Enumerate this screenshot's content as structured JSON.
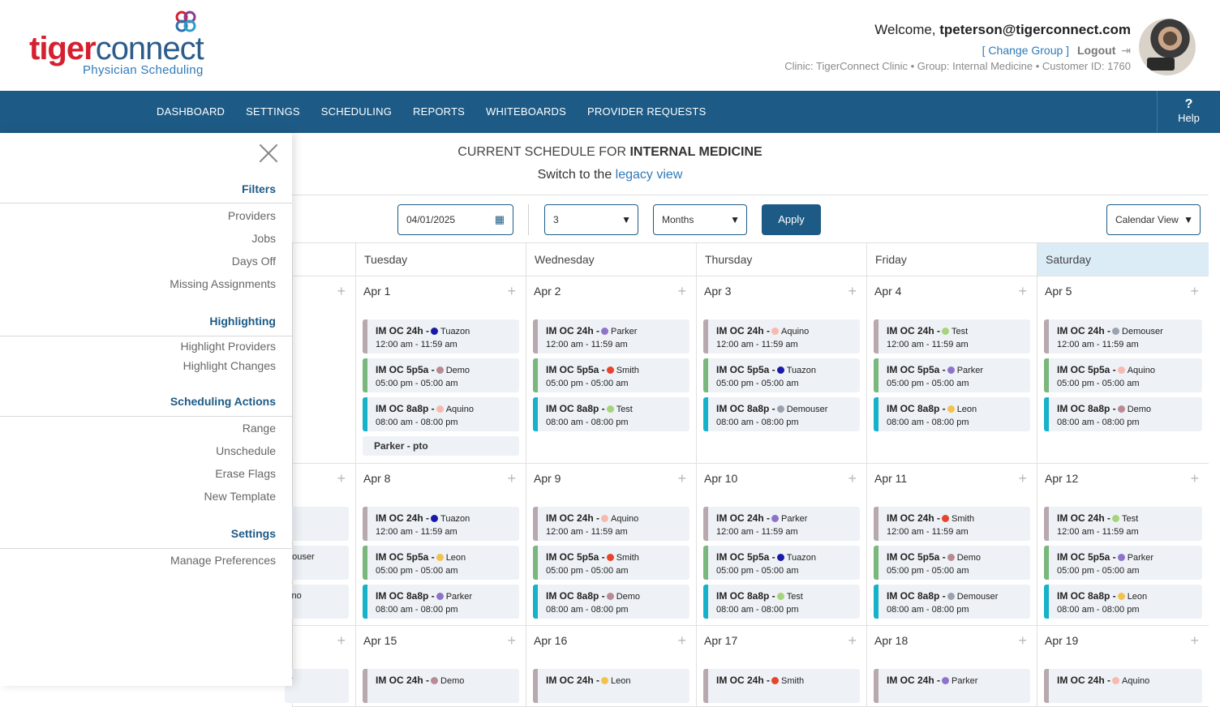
{
  "brand": {
    "word_a": "tiger",
    "word_b": "connect",
    "subtitle": "Physician Scheduling",
    "colors": {
      "red": "#d6202f",
      "blue": "#2c5c8a",
      "nav": "#1d5b86"
    }
  },
  "account": {
    "welcome_prefix": "Welcome,",
    "user": "tpeterson@tigerconnect.com",
    "change_group": "[ Change Group ]",
    "logout": "Logout",
    "clinic_line": "Clinic: TigerConnect Clinic • Group: Internal Medicine • Customer ID: 1760"
  },
  "nav": {
    "items": [
      "DASHBOARD",
      "SETTINGS",
      "SCHEDULING",
      "REPORTS",
      "WHITEBOARDS",
      "PROVIDER REQUESTS"
    ],
    "help_icon": "?",
    "help_label": "Help"
  },
  "page": {
    "title_prefix": "CURRENT SCHEDULE FOR",
    "title_group": "INTERNAL MEDICINE",
    "switch_prefix": "Switch to the",
    "switch_link": "legacy view"
  },
  "toolbar": {
    "date_value": "04/01/2025",
    "count_value": "3",
    "unit_value": "Months",
    "apply_label": "Apply",
    "view_value": "Calendar View"
  },
  "sidebar": {
    "sections": [
      {
        "title": "Filters",
        "items": [
          "Providers",
          "Jobs",
          "Days Off",
          "Missing Assignments"
        ]
      },
      {
        "title": "Highlighting",
        "items": [
          "Highlight Providers",
          "Highlight Changes"
        ]
      },
      {
        "title": "Scheduling Actions",
        "items": [
          "Range",
          "Unschedule",
          "Erase Flags",
          "New Template"
        ]
      },
      {
        "title": "Settings",
        "items": [
          "Manage Preferences"
        ]
      }
    ]
  },
  "calendar": {
    "days": [
      "Tuesday",
      "Wednesday",
      "Thursday",
      "Friday",
      "Saturday"
    ],
    "provider_colors": {
      "Tuazon": "#1a1aa8",
      "Parker": "#8f72cc",
      "Aquino": "#f7b9b0",
      "Test": "#a6d47a",
      "Demouser": "#9aa3ad",
      "Demo": "#b98a94",
      "Smith": "#e8432c",
      "Leon": "#f3c24e"
    },
    "weeks": [
      {
        "days": [
          {
            "label": "Apr 1",
            "shifts": [
              {
                "job": "IM OC 24h -",
                "provider": "Tuazon",
                "time": "12:00 am - 11:59 am",
                "cls": ""
              },
              {
                "job": "IM OC 5p5a -",
                "provider": "Demo",
                "time": "05:00 pm - 05:00 am",
                "cls": "c-green"
              },
              {
                "job": "IM OC 8a8p -",
                "provider": "Aquino",
                "time": "08:00 am - 08:00 pm",
                "cls": "c-cyan"
              }
            ],
            "pto": "Parker - pto"
          },
          {
            "label": "Apr 2",
            "shifts": [
              {
                "job": "IM OC 24h -",
                "provider": "Parker",
                "time": "12:00 am - 11:59 am",
                "cls": ""
              },
              {
                "job": "IM OC 5p5a -",
                "provider": "Smith",
                "time": "05:00 pm - 05:00 am",
                "cls": "c-green"
              },
              {
                "job": "IM OC 8a8p -",
                "provider": "Test",
                "time": "08:00 am - 08:00 pm",
                "cls": "c-cyan"
              }
            ]
          },
          {
            "label": "Apr 3",
            "shifts": [
              {
                "job": "IM OC 24h -",
                "provider": "Aquino",
                "time": "12:00 am - 11:59 am",
                "cls": ""
              },
              {
                "job": "IM OC 5p5a -",
                "provider": "Tuazon",
                "time": "05:00 pm - 05:00 am",
                "cls": "c-green"
              },
              {
                "job": "IM OC 8a8p -",
                "provider": "Demouser",
                "time": "08:00 am - 08:00 pm",
                "cls": "c-cyan"
              }
            ]
          },
          {
            "label": "Apr 4",
            "shifts": [
              {
                "job": "IM OC 24h -",
                "provider": "Test",
                "time": "12:00 am - 11:59 am",
                "cls": ""
              },
              {
                "job": "IM OC 5p5a -",
                "provider": "Parker",
                "time": "05:00 pm - 05:00 am",
                "cls": "c-green"
              },
              {
                "job": "IM OC 8a8p -",
                "provider": "Leon",
                "time": "08:00 am - 08:00 pm",
                "cls": "c-cyan"
              }
            ]
          },
          {
            "label": "Apr 5",
            "shifts": [
              {
                "job": "IM OC 24h -",
                "provider": "Demouser",
                "time": "12:00 am - 11:59 am",
                "cls": ""
              },
              {
                "job": "IM OC 5p5a -",
                "provider": "Aquino",
                "time": "05:00 pm - 05:00 am",
                "cls": "c-green"
              },
              {
                "job": "IM OC 8a8p -",
                "provider": "Demo",
                "time": "08:00 am - 08:00 pm",
                "cls": "c-cyan"
              }
            ]
          }
        ],
        "left_peek": []
      },
      {
        "days": [
          {
            "label": "Apr 8",
            "shifts": [
              {
                "job": "IM OC 24h -",
                "provider": "Tuazon",
                "time": "12:00 am - 11:59 am",
                "cls": ""
              },
              {
                "job": "IM OC 5p5a -",
                "provider": "Leon",
                "time": "05:00 pm - 05:00 am",
                "cls": "c-green"
              },
              {
                "job": "IM OC 8a8p -",
                "provider": "Parker",
                "time": "08:00 am - 08:00 pm",
                "cls": "c-cyan"
              }
            ]
          },
          {
            "label": "Apr 9",
            "shifts": [
              {
                "job": "IM OC 24h -",
                "provider": "Aquino",
                "time": "12:00 am - 11:59 am",
                "cls": ""
              },
              {
                "job": "IM OC 5p5a -",
                "provider": "Smith",
                "time": "05:00 pm - 05:00 am",
                "cls": "c-green"
              },
              {
                "job": "IM OC 8a8p -",
                "provider": "Demo",
                "time": "08:00 am - 08:00 pm",
                "cls": "c-cyan"
              }
            ]
          },
          {
            "label": "Apr 10",
            "shifts": [
              {
                "job": "IM OC 24h -",
                "provider": "Parker",
                "time": "12:00 am - 11:59 am",
                "cls": ""
              },
              {
                "job": "IM OC 5p5a -",
                "provider": "Tuazon",
                "time": "05:00 pm - 05:00 am",
                "cls": "c-green"
              },
              {
                "job": "IM OC 8a8p -",
                "provider": "Test",
                "time": "08:00 am - 08:00 pm",
                "cls": "c-cyan"
              }
            ]
          },
          {
            "label": "Apr 11",
            "shifts": [
              {
                "job": "IM OC 24h -",
                "provider": "Smith",
                "time": "12:00 am - 11:59 am",
                "cls": ""
              },
              {
                "job": "IM OC 5p5a -",
                "provider": "Demo",
                "time": "05:00 pm - 05:00 am",
                "cls": "c-green"
              },
              {
                "job": "IM OC 8a8p -",
                "provider": "Demouser",
                "time": "08:00 am - 08:00 pm",
                "cls": "c-cyan"
              }
            ]
          },
          {
            "label": "Apr 12",
            "shifts": [
              {
                "job": "IM OC 24h -",
                "provider": "Test",
                "time": "12:00 am - 11:59 am",
                "cls": ""
              },
              {
                "job": "IM OC 5p5a -",
                "provider": "Parker",
                "time": "05:00 pm - 05:00 am",
                "cls": "c-green"
              },
              {
                "job": "IM OC 8a8p -",
                "provider": "Leon",
                "time": "08:00 am - 08:00 pm",
                "cls": "c-cyan"
              }
            ]
          }
        ],
        "left_peek": [
          "o",
          "mouser",
          "uino"
        ]
      },
      {
        "days": [
          {
            "label": "Apr 15",
            "shifts": [
              {
                "job": "IM OC 24h -",
                "provider": "Demo",
                "time": "",
                "cls": ""
              }
            ]
          },
          {
            "label": "Apr 16",
            "shifts": [
              {
                "job": "IM OC 24h -",
                "provider": "Leon",
                "time": "",
                "cls": ""
              }
            ]
          },
          {
            "label": "Apr 17",
            "shifts": [
              {
                "job": "IM OC 24h -",
                "provider": "Smith",
                "time": "",
                "cls": ""
              }
            ]
          },
          {
            "label": "Apr 18",
            "shifts": [
              {
                "job": "IM OC 24h -",
                "provider": "Parker",
                "time": "",
                "cls": ""
              }
            ]
          },
          {
            "label": "Apr 19",
            "shifts": [
              {
                "job": "IM OC 24h -",
                "provider": "Aquino",
                "time": "",
                "cls": ""
              }
            ]
          }
        ],
        "left_peek": [
          "er"
        ]
      }
    ]
  }
}
